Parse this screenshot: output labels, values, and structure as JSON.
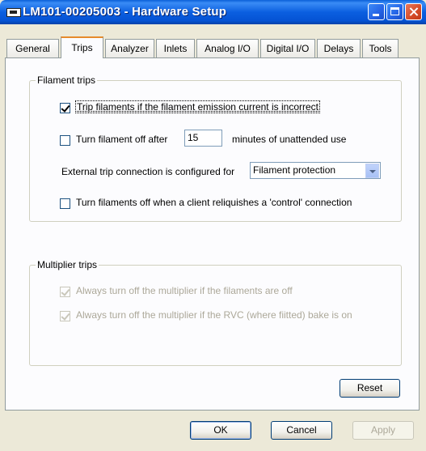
{
  "window": {
    "title": "LM101-00205003 - Hardware Setup"
  },
  "tabs": [
    "General",
    "Trips",
    "Analyzer",
    "Inlets",
    "Analog I/O",
    "Digital I/O",
    "Delays",
    "Tools"
  ],
  "active_tab": "Trips",
  "filament_trips": {
    "legend": "Filament trips",
    "trip_emission": {
      "label": "Trip filaments if the filament emission current is incorrect",
      "checked": true
    },
    "turn_off_after": {
      "label": "Turn filament off after",
      "value": "15",
      "suffix": "minutes of unattended use",
      "checked": false
    },
    "external_trip": {
      "label": "External trip connection is configured for",
      "selected": "Filament protection"
    },
    "turn_off_client": {
      "label": "Turn filaments off when a client reliquishes a 'control' connection",
      "checked": false
    }
  },
  "multiplier_trips": {
    "legend": "Multiplier trips",
    "off_if_filaments_off": {
      "label": "Always turn off the multiplier if the filaments are off",
      "checked": true,
      "enabled": false
    },
    "off_if_bake_on": {
      "label": "Always turn off the multiplier if the RVC (where fiitted) bake is on",
      "checked": true,
      "enabled": false
    }
  },
  "buttons": {
    "reset": "Reset",
    "ok": "OK",
    "cancel": "Cancel",
    "apply": "Apply"
  }
}
